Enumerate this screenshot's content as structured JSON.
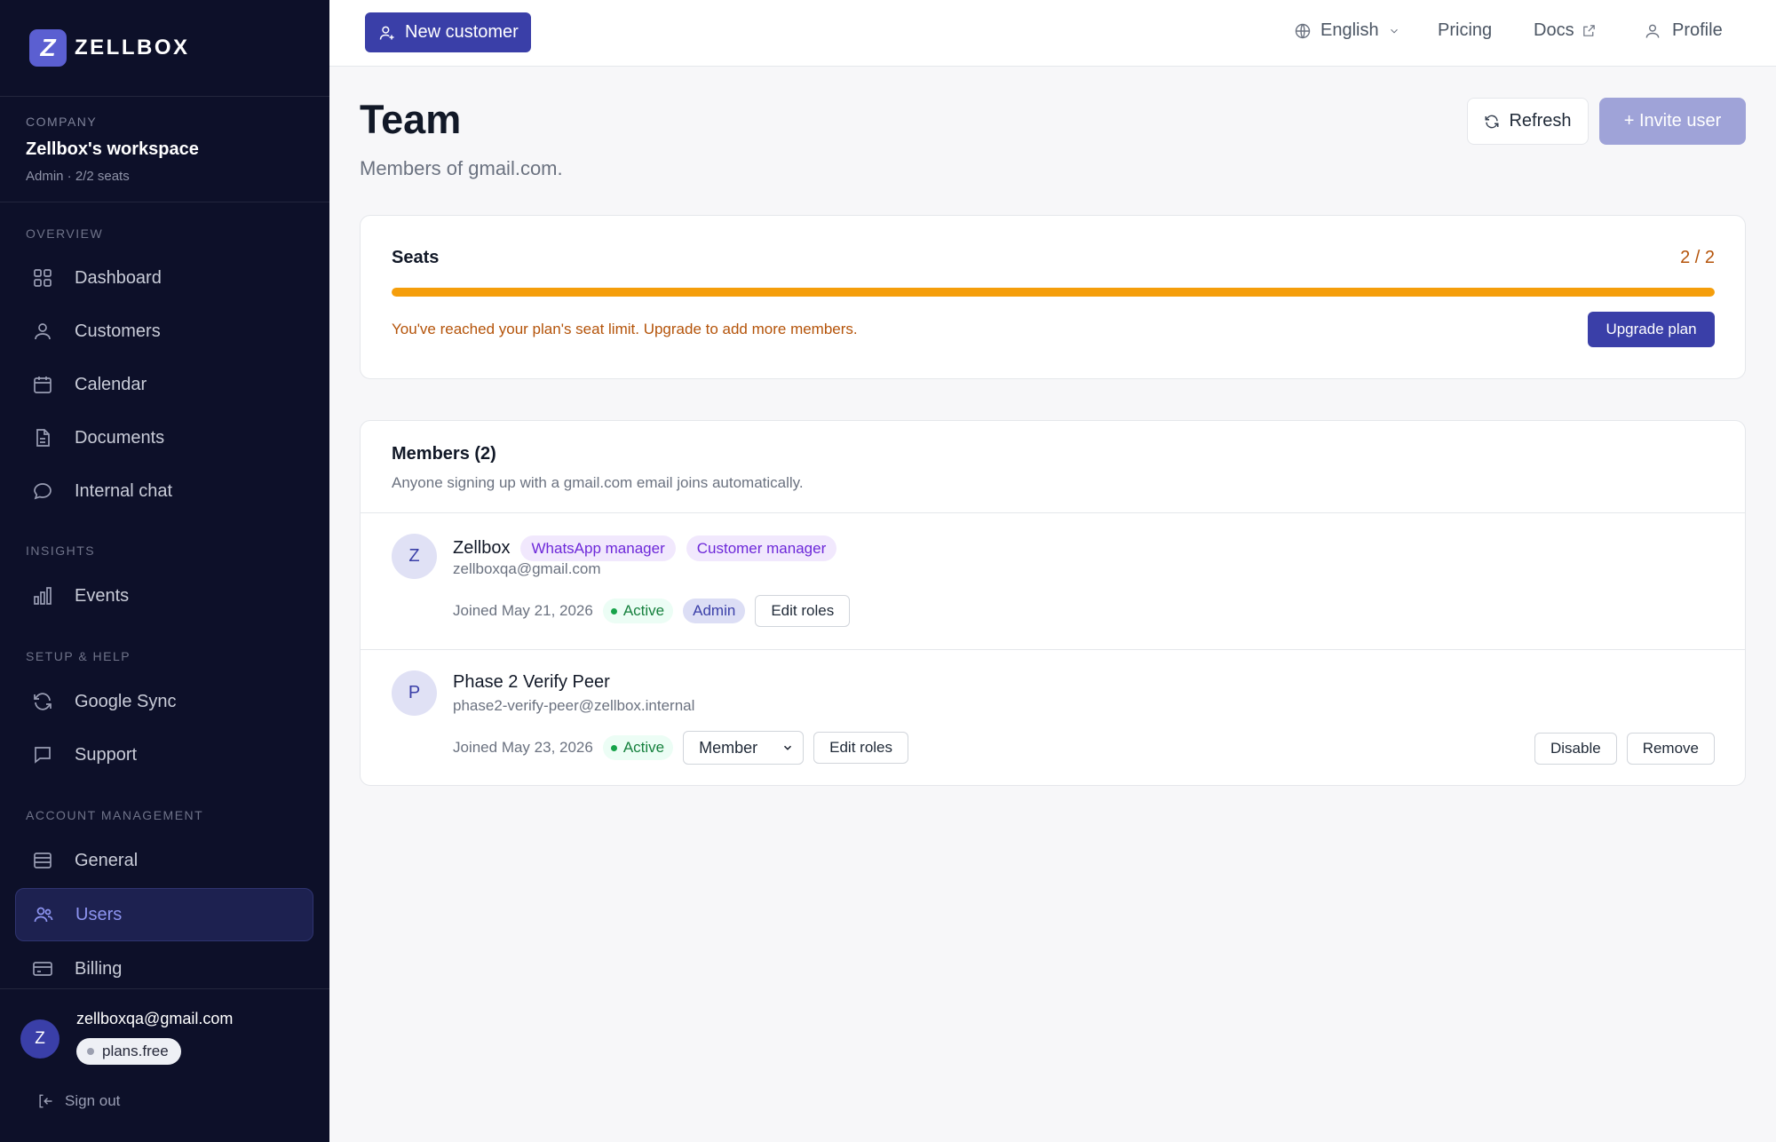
{
  "brand": {
    "logo_letter": "Z",
    "name": "ZELLBOX"
  },
  "company": {
    "label": "COMPANY",
    "workspace": "Zellbox's workspace",
    "meta": "Admin · 2/2 seats"
  },
  "sidebar": {
    "sections": [
      {
        "label": "OVERVIEW"
      },
      {
        "label": "INSIGHTS"
      },
      {
        "label": "SETUP & HELP"
      },
      {
        "label": "ACCOUNT MANAGEMENT"
      }
    ],
    "items": [
      {
        "label": "Dashboard",
        "icon": "grid-icon"
      },
      {
        "label": "Customers",
        "icon": "user-icon"
      },
      {
        "label": "Calendar",
        "icon": "calendar-icon"
      },
      {
        "label": "Documents",
        "icon": "document-icon"
      },
      {
        "label": "Internal chat",
        "icon": "chat-icon"
      },
      {
        "label": "Events",
        "icon": "bar-chart-icon"
      },
      {
        "label": "Google Sync",
        "icon": "sync-icon"
      },
      {
        "label": "Support",
        "icon": "support-chat-icon"
      },
      {
        "label": "General",
        "icon": "list-icon"
      },
      {
        "label": "Users",
        "icon": "users-icon",
        "active": true
      },
      {
        "label": "Billing",
        "icon": "credit-card-icon"
      }
    ],
    "footer": {
      "avatar_letter": "Z",
      "email": "zellboxqa@gmail.com",
      "plan": "plans.free",
      "signout": "Sign out"
    }
  },
  "topbar": {
    "new_customer": "New customer",
    "language": "English",
    "pricing": "Pricing",
    "docs": "Docs",
    "profile": "Profile"
  },
  "page": {
    "title": "Team",
    "subtitle": "Members of gmail.com.",
    "refresh": "Refresh",
    "invite": "+ Invite user"
  },
  "seats": {
    "title": "Seats",
    "count": "2 / 2",
    "used_fraction": 1.0,
    "warning": "You've reached your plan's seat limit. Upgrade to add more members.",
    "upgrade": "Upgrade plan"
  },
  "members": {
    "title": "Members (2)",
    "description": "Anyone signing up with a gmail.com email joins automatically.",
    "list": [
      {
        "avatar": "Z",
        "name": "Zellbox",
        "tags": [
          "WhatsApp manager",
          "Customer manager"
        ],
        "email": "zellboxqa@gmail.com",
        "joined": "Joined May 21, 2026",
        "status": "Active",
        "role": "Admin",
        "edit_roles": "Edit roles"
      },
      {
        "avatar": "P",
        "name": "Phase 2 Verify Peer",
        "email": "phase2-verify-peer@zellbox.internal",
        "joined": "Joined May 23, 2026",
        "status": "Active",
        "role_select": "Member",
        "edit_roles": "Edit roles",
        "disable": "Disable",
        "remove": "Remove"
      }
    ]
  },
  "colors": {
    "sidebar_bg": "#0d1029",
    "accent": "#3a3fa8",
    "warning": "#b45309",
    "progress": "#f59e0b",
    "success": "#15803d"
  }
}
